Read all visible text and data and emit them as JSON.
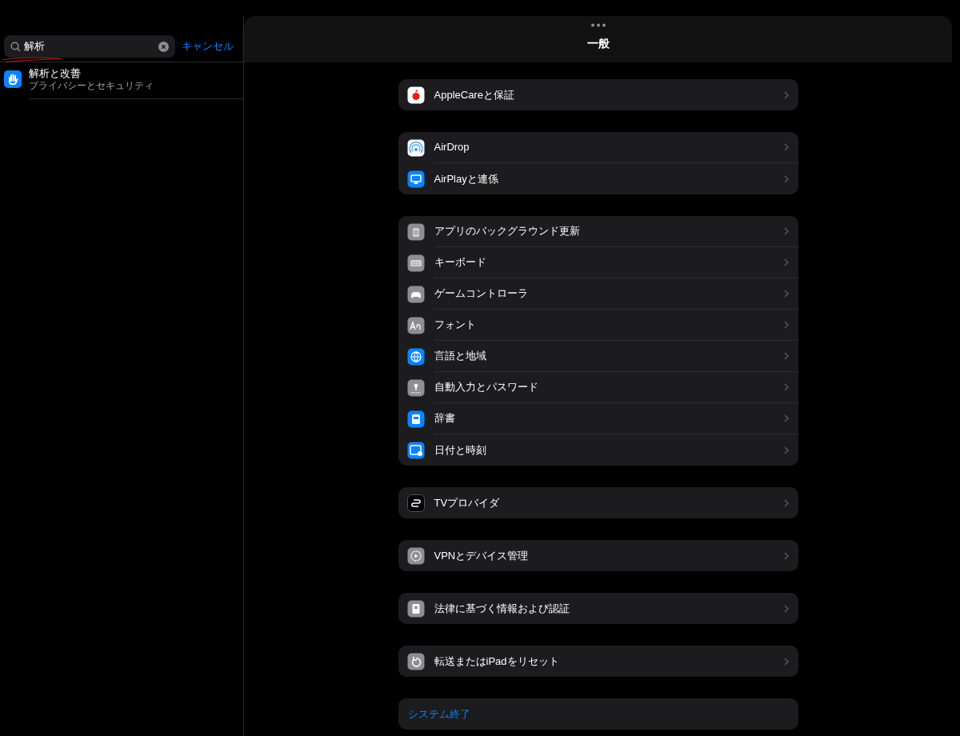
{
  "sidebar": {
    "search": {
      "value": "解析",
      "cancel": "キャンセル"
    },
    "results": [
      {
        "title": "解析と改善",
        "subtitle": "プライバシーとセキュリティ",
        "color": "#0a84ff"
      }
    ]
  },
  "detail": {
    "title": "一般",
    "groups": [
      {
        "rows": [
          {
            "label": "AppleCareと保証",
            "color": "#ffffff"
          }
        ]
      },
      {
        "rows": [
          {
            "label": "AirDrop",
            "color": "#ffffff"
          },
          {
            "label": "AirPlayと連係",
            "color": "#0a84ff"
          }
        ]
      },
      {
        "rows": [
          {
            "label": "アプリのバックグラウンド更新",
            "color": "#8e8e93"
          },
          {
            "label": "キーボード",
            "color": "#8e8e93"
          },
          {
            "label": "ゲームコントローラ",
            "color": "#8e8e93"
          },
          {
            "label": "フォント",
            "color": "#8e8e93"
          },
          {
            "label": "言語と地域",
            "color": "#0a84ff"
          },
          {
            "label": "自動入力とパスワード",
            "color": "#8e8e93"
          },
          {
            "label": "辞書",
            "color": "#0a84ff"
          },
          {
            "label": "日付と時刻",
            "color": "#0a84ff"
          }
        ]
      },
      {
        "rows": [
          {
            "label": "TVプロバイダ",
            "color": "#000000"
          }
        ]
      },
      {
        "rows": [
          {
            "label": "VPNとデバイス管理",
            "color": "#8e8e93"
          }
        ]
      },
      {
        "rows": [
          {
            "label": "法律に基づく情報および認証",
            "color": "#8e8e93"
          }
        ]
      },
      {
        "rows": [
          {
            "label": "転送またはiPadをリセット",
            "color": "#8e8e93"
          }
        ]
      },
      {
        "rows": [
          {
            "label": "システム終了",
            "kind": "action"
          }
        ]
      }
    ]
  }
}
